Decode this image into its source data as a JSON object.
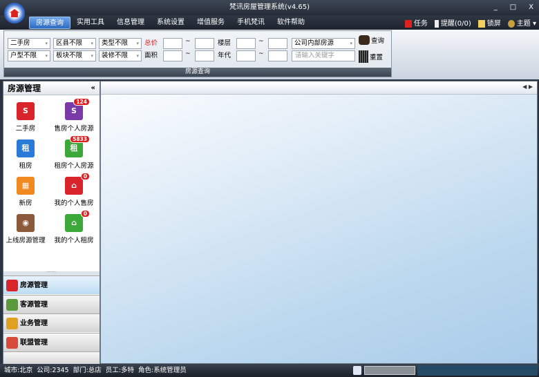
{
  "window": {
    "title": "梵讯房屋管理系统(v4.65)",
    "minimize": "_",
    "maximize": "□",
    "close": "X"
  },
  "menu": [
    {
      "label": "房源查询",
      "active": true
    },
    {
      "label": "实用工具"
    },
    {
      "label": "信息管理"
    },
    {
      "label": "系统设置"
    },
    {
      "label": "增值服务"
    },
    {
      "label": "手机梵讯"
    },
    {
      "label": "软件帮助"
    }
  ],
  "tools": {
    "task": "任务",
    "remind": "提醒(0/0)",
    "lock": "锁屏",
    "theme": "主题"
  },
  "query": {
    "selects": {
      "type": "二手房",
      "district": "区县不限",
      "category": "类型不限",
      "layout": "户型不限",
      "block": "板块不限",
      "decoration": "装修不限",
      "source": "公司内部房源"
    },
    "labels": {
      "price": "总价",
      "area": "面积",
      "floor": "楼层",
      "year": "年代",
      "tilde": "~"
    },
    "keyword_placeholder": "请输入关键字",
    "search": "查询",
    "reset": "重置",
    "footer": "房源查询"
  },
  "sidebar": {
    "title": "房源管理",
    "collapse": "«",
    "items": [
      {
        "label": "二手房",
        "color": "#d8242a",
        "glyph": "S"
      },
      {
        "label": "售房个人房源",
        "color": "#7a3aa8",
        "glyph": "S",
        "badge": "124"
      },
      {
        "label": "租房",
        "color": "#2a7ad8",
        "glyph": "租"
      },
      {
        "label": "租房个人房源",
        "color": "#3ca83a",
        "glyph": "租",
        "badge": "5833"
      },
      {
        "label": "新房",
        "color": "#f08a20",
        "glyph": "▦"
      },
      {
        "label": "我的个人售房",
        "color": "#d8242a",
        "glyph": "⌂",
        "badge": "0"
      },
      {
        "label": "上线房源管理",
        "color": "#8a5a3a",
        "glyph": "◉"
      },
      {
        "label": "我的个人租房",
        "color": "#3ca83a",
        "glyph": "⌂",
        "badge": "0"
      }
    ],
    "nav": [
      {
        "label": "房源管理",
        "color": "#d8242a"
      },
      {
        "label": "客源管理",
        "color": "#5a9a3a"
      },
      {
        "label": "业务管理",
        "color": "#e0a020"
      },
      {
        "label": "联盟管理",
        "color": "#d84a3a"
      }
    ]
  },
  "status": {
    "city": "城市:北京",
    "company": "公司:2345",
    "dept": "部门:总店",
    "staff": "员工:多特",
    "role": "角色:系统管理员"
  }
}
